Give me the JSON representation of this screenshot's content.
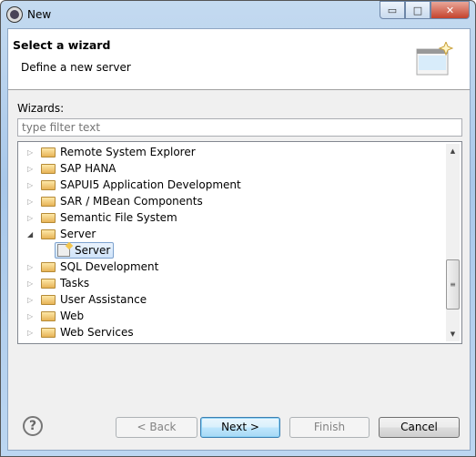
{
  "window": {
    "title": "New"
  },
  "header": {
    "title": "Select a wizard",
    "description": "Define a new server"
  },
  "wizards_label": "Wizards:",
  "filter": {
    "placeholder": "type filter text",
    "value": ""
  },
  "tree": [
    {
      "label": "Remote System Explorer",
      "expanded": false
    },
    {
      "label": "SAP HANA",
      "expanded": false
    },
    {
      "label": "SAPUI5 Application Development",
      "expanded": false
    },
    {
      "label": "SAR / MBean Components",
      "expanded": false
    },
    {
      "label": "Semantic File System",
      "expanded": false
    },
    {
      "label": "Server",
      "expanded": true,
      "children": [
        {
          "label": "Server",
          "selected": true
        }
      ]
    },
    {
      "label": "SQL Development",
      "expanded": false
    },
    {
      "label": "Tasks",
      "expanded": false
    },
    {
      "label": "User Assistance",
      "expanded": false
    },
    {
      "label": "Web",
      "expanded": false
    },
    {
      "label": "Web Services",
      "expanded": false
    }
  ],
  "buttons": {
    "back": "< Back",
    "next": "Next >",
    "finish": "Finish",
    "cancel": "Cancel"
  },
  "button_states": {
    "back": "disabled",
    "next": "default",
    "finish": "disabled",
    "cancel": "enabled"
  }
}
